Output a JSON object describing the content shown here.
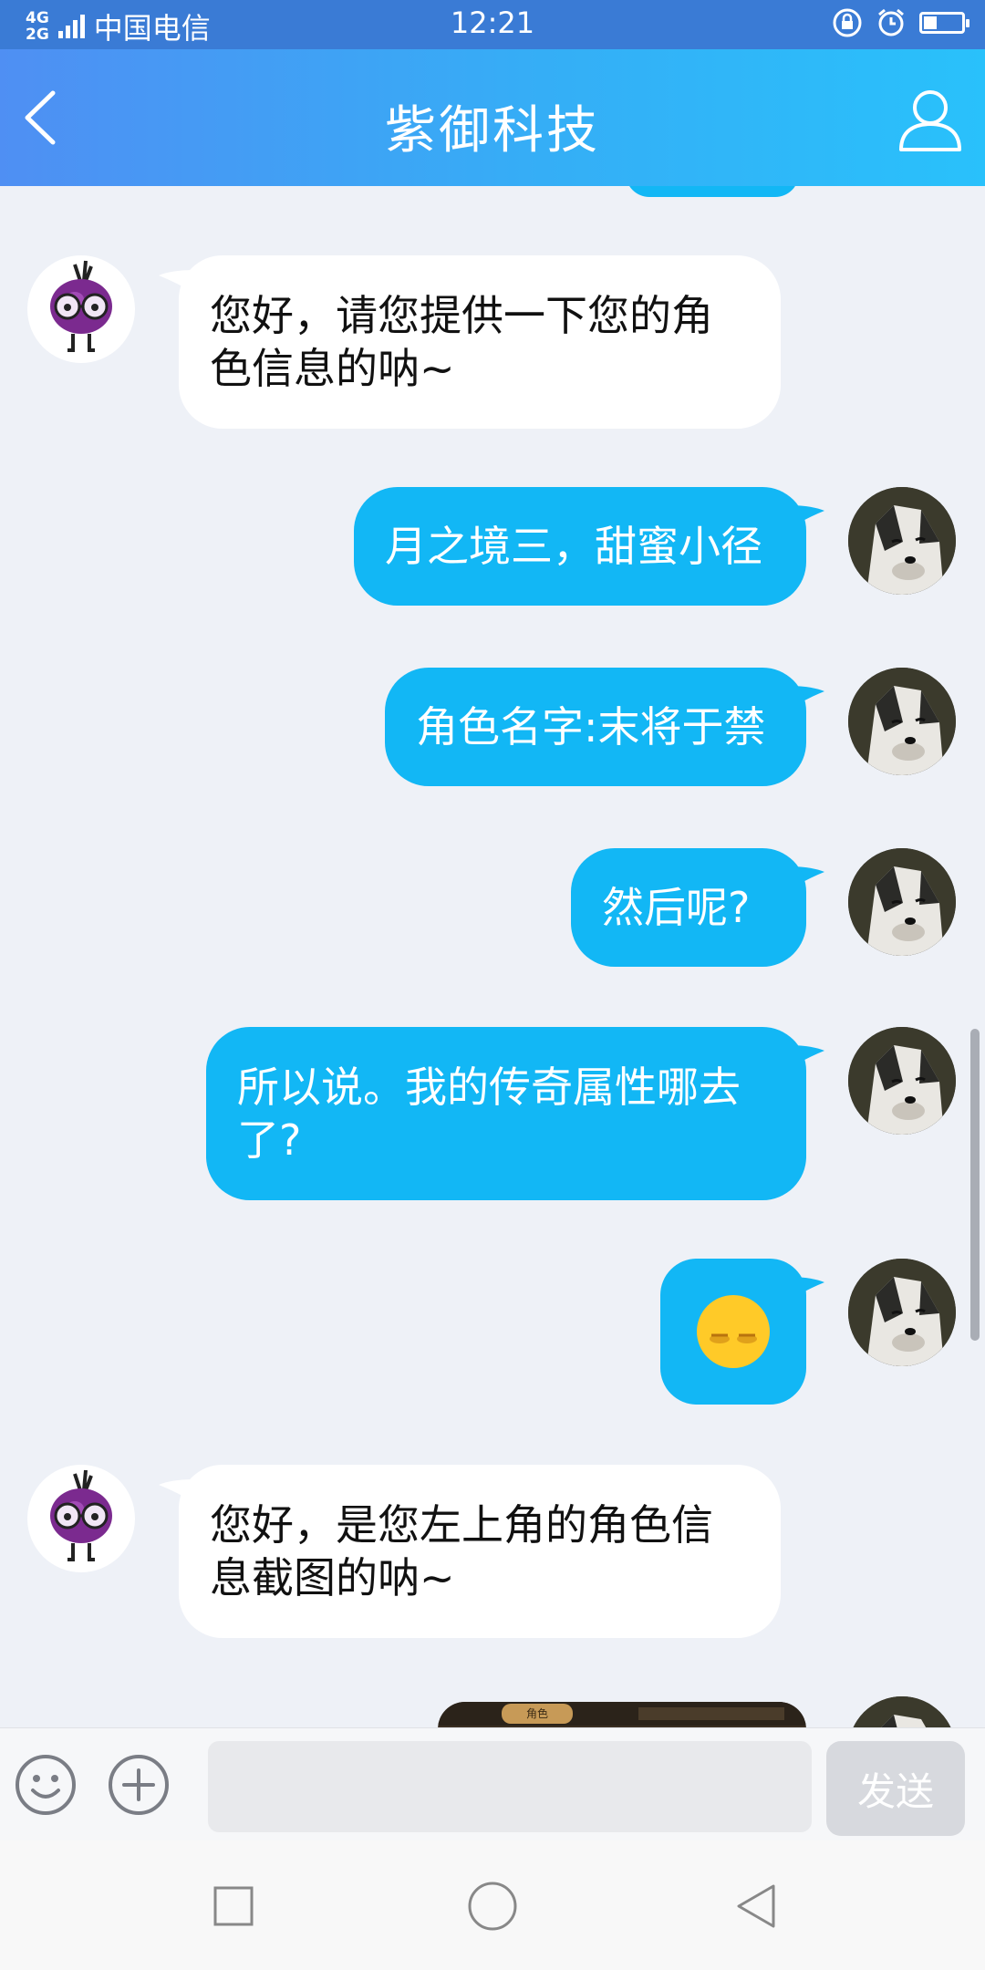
{
  "status_bar": {
    "network": "4G",
    "network2": "2G",
    "carrier": "中国电信",
    "time": "12:21"
  },
  "header": {
    "title": "紫御科技",
    "back_icon": "chevron-left-icon",
    "profile_icon": "user-icon"
  },
  "messages": [
    {
      "side": "incoming",
      "sender_avatar": "purple-mascot",
      "text": "您好，请您提供一下您的角色信息的呐~"
    },
    {
      "side": "outgoing",
      "sender_avatar": "husky",
      "text": "月之境三，甜蜜小径"
    },
    {
      "side": "outgoing",
      "sender_avatar": "husky",
      "text": "角色名字:末将于禁"
    },
    {
      "side": "outgoing",
      "sender_avatar": "husky",
      "text": "然后呢?"
    },
    {
      "side": "outgoing",
      "sender_avatar": "husky",
      "text": "所以说。我的传奇属性哪去了?"
    },
    {
      "side": "outgoing",
      "sender_avatar": "husky",
      "emoji": "sleepy-face-emoji"
    },
    {
      "side": "incoming",
      "sender_avatar": "purple-mascot",
      "text": "您好，是您左上角的角色信息截图的呐~"
    },
    {
      "side": "outgoing",
      "sender_avatar": "husky",
      "image": "game-screenshot",
      "image_caption": "角色"
    }
  ],
  "input_bar": {
    "emoji_icon": "smiley-icon",
    "plus_icon": "plus-circle-icon",
    "input_value": "",
    "send_label": "发送"
  },
  "nav_bar": {
    "recent_icon": "square-icon",
    "home_icon": "circle-icon",
    "back_icon": "triangle-back-icon"
  },
  "colors": {
    "header_start": "#4f8ff3",
    "header_end": "#29c1fb",
    "outgoing_bubble": "#12b7f5",
    "incoming_bubble": "#ffffff",
    "chat_background": "#eef1f7"
  }
}
